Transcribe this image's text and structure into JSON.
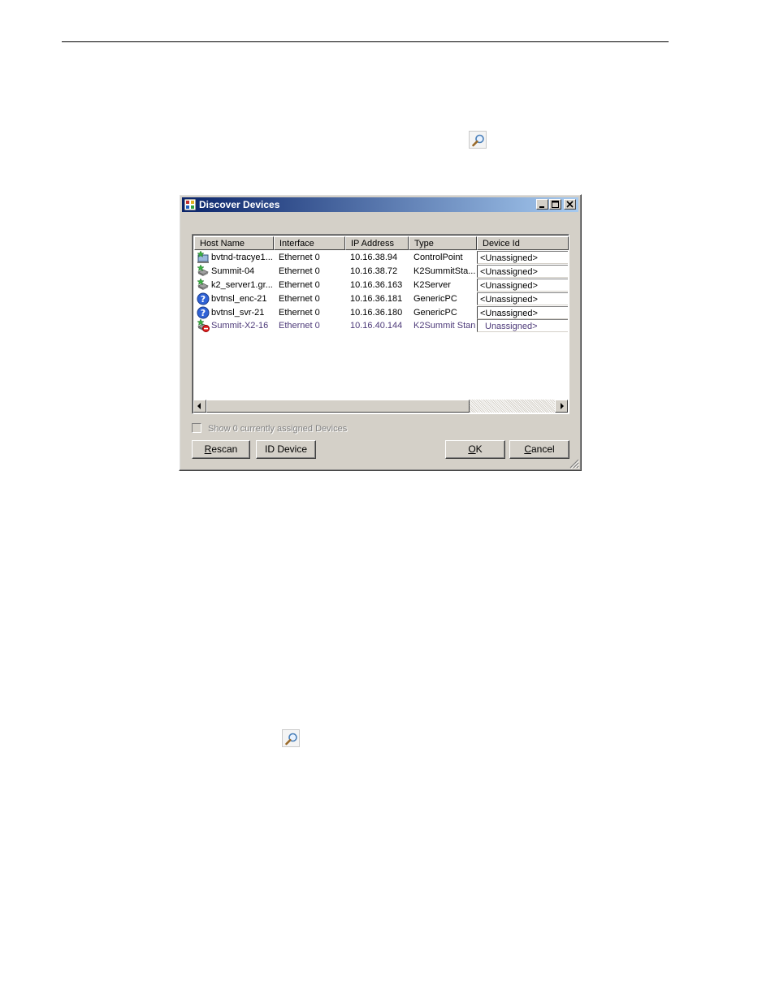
{
  "window": {
    "title": "Discover Devices"
  },
  "list": {
    "columns": [
      "Host Name",
      "Interface",
      "IP Address",
      "Type",
      "Device Id"
    ],
    "rows": [
      {
        "icon": "workstation-star-icon",
        "host": "bvtnd-tracye1...",
        "interface": "Ethernet 0",
        "ip": "10.16.38.94",
        "type": "ControlPoint",
        "device_id": "<Unassigned>"
      },
      {
        "icon": "server-star-icon",
        "host": "Summit-04",
        "interface": "Ethernet 0",
        "ip": "10.16.38.72",
        "type": "K2SummitSta...",
        "device_id": "<Unassigned>"
      },
      {
        "icon": "server-star-icon",
        "host": "k2_server1.gr...",
        "interface": "Ethernet 0",
        "ip": "10.16.36.163",
        "type": "K2Server",
        "device_id": "<Unassigned>"
      },
      {
        "icon": "question-icon",
        "host": "bvtnsl_enc-21",
        "interface": "Ethernet 0",
        "ip": "10.16.36.181",
        "type": "GenericPC",
        "device_id": "<Unassigned>"
      },
      {
        "icon": "question-icon",
        "host": "bvtnsl_svr-21",
        "interface": "Ethernet 0",
        "ip": "10.16.36.180",
        "type": "GenericPC",
        "device_id": "<Unassigned>"
      },
      {
        "icon": "server-blocked-icon",
        "host": "Summit-X2-16",
        "interface": "Ethernet 0",
        "ip": "10.16.40.144",
        "type": "K2Summit Stan.",
        "device_id": "Unassigned>"
      }
    ]
  },
  "checkbox": {
    "label": "Show 0 currently assigned Devices",
    "checked": false
  },
  "buttons": {
    "rescan": {
      "mnemonic": "R",
      "rest": "escan"
    },
    "id_device": "ID Device",
    "ok": {
      "mnemonic": "O",
      "rest": "K"
    },
    "cancel": {
      "mnemonic": "C",
      "rest": "ancel"
    }
  },
  "colors": {
    "titlebar_start": "#0a246a",
    "titlebar_end": "#a6caf0",
    "face": "#d4d0c8",
    "disabled_row_text": "#4d3a79"
  }
}
